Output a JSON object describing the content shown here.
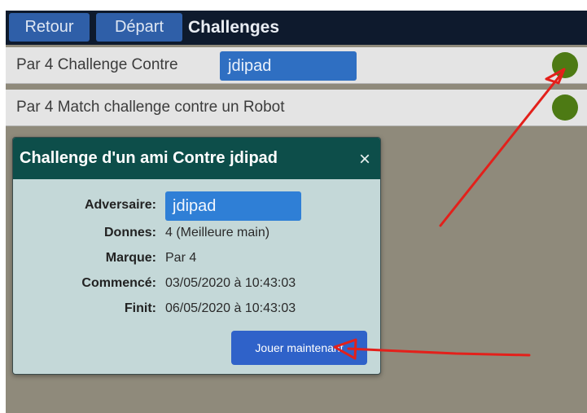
{
  "topbar": {
    "back_label": "Retour",
    "home_label": "Départ",
    "title": "Challenges"
  },
  "list": [
    {
      "text": "Par 4 Challenge Contre",
      "opponent": "jdipad",
      "status_color": "#4d7a14"
    },
    {
      "text": "Par 4 Match challenge contre un Robot",
      "status_color": "#4d7a14"
    }
  ],
  "dialog": {
    "title": "Challenge d'un ami Contre jdipad",
    "close_glyph": "×",
    "fields": {
      "adversaire_label": "Adversaire:",
      "adversaire_value": "jdipad",
      "donnes_label": "Donnes:",
      "donnes_value": "4 (Meilleure main)",
      "marque_label": "Marque:",
      "marque_value": "Par 4",
      "commence_label": "Commencé:",
      "commence_value": "03/05/2020 à 10:43:03",
      "finit_label": "Finit:",
      "finit_value": "06/05/2020 à 10:43:03"
    },
    "play_label": "Jouer maintenant"
  },
  "colors": {
    "topbar_bg": "#0e1a2d",
    "nav_button": "#2f5fa8",
    "dialog_header": "#0d4e4a",
    "dialog_body": "#c4d8d8",
    "status_dot": "#4d7a14",
    "annotation_arrow": "#e3201b"
  }
}
